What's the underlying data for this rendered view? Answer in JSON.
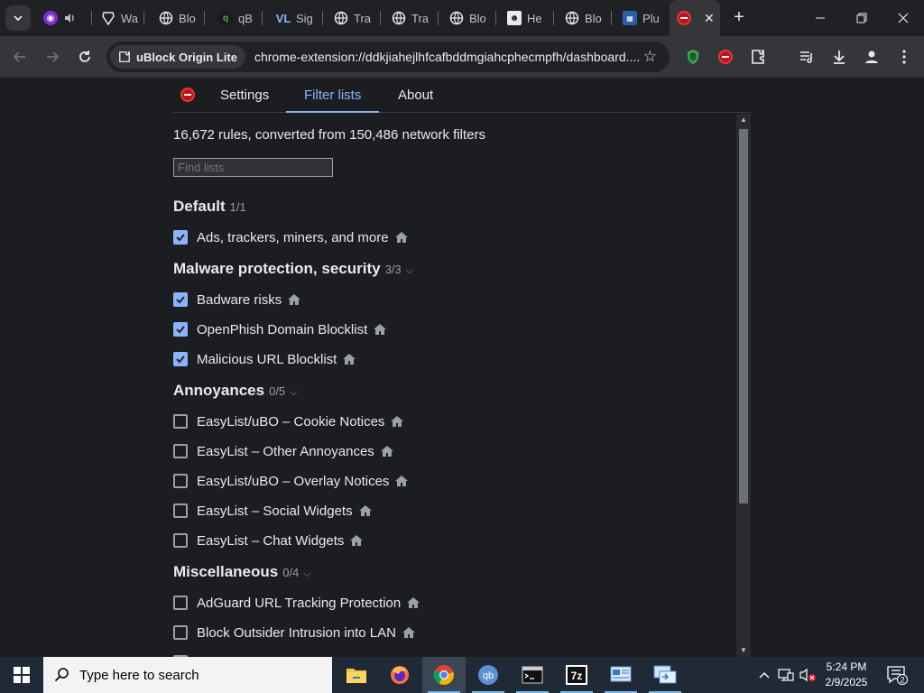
{
  "browser": {
    "tabs": [
      {
        "label": "",
        "icon": "tor-icon"
      },
      {
        "label": "Wa",
        "icon": "brave-icon"
      },
      {
        "label": "Blo",
        "icon": "globe-icon"
      },
      {
        "label": "qB",
        "icon": "qbittorrent-icon"
      },
      {
        "label": "Sig",
        "icon": "vl-icon"
      },
      {
        "label": "Tra",
        "icon": "globe-icon"
      },
      {
        "label": "Tra",
        "icon": "globe-icon"
      },
      {
        "label": "Blo",
        "icon": "globe-icon"
      },
      {
        "label": "He",
        "icon": "hero-icon"
      },
      {
        "label": "Blo",
        "icon": "globe-icon"
      },
      {
        "label": "Plu",
        "icon": "plugin-icon"
      },
      {
        "label": "",
        "icon": "ublock-icon",
        "active": true
      }
    ],
    "extension_chip": "uBlock Origin Lite",
    "url": "chrome-extension://ddkjiahejlhfcafbddmgiahcphecmpfh/dashboard...."
  },
  "dashboard": {
    "nav": {
      "settings": "Settings",
      "filter_lists": "Filter lists",
      "about": "About"
    },
    "summary": "16,672 rules, converted from 150,486 network filters",
    "search_placeholder": "Find lists",
    "groups": [
      {
        "name": "Default",
        "count": "1/1",
        "collapsible": false,
        "lists": [
          {
            "label": "Ads, trackers, miners, and more",
            "checked": true
          }
        ]
      },
      {
        "name": "Malware protection, security",
        "count": "3/3",
        "collapsible": true,
        "lists": [
          {
            "label": "Badware risks",
            "checked": true
          },
          {
            "label": "OpenPhish Domain Blocklist",
            "checked": true
          },
          {
            "label": "Malicious URL Blocklist",
            "checked": true
          }
        ]
      },
      {
        "name": "Annoyances",
        "count": "0/5",
        "collapsible": true,
        "lists": [
          {
            "label": "EasyList/uBO – Cookie Notices",
            "checked": false
          },
          {
            "label": "EasyList – Other Annoyances",
            "checked": false
          },
          {
            "label": "EasyList/uBO – Overlay Notices",
            "checked": false
          },
          {
            "label": "EasyList – Social Widgets",
            "checked": false
          },
          {
            "label": "EasyList – Chat Widgets",
            "checked": false
          }
        ]
      },
      {
        "name": "Miscellaneous",
        "count": "0/4",
        "collapsible": true,
        "lists": [
          {
            "label": "AdGuard URL Tracking Protection",
            "checked": false
          },
          {
            "label": "Block Outsider Intrusion into LAN",
            "checked": false
          }
        ]
      }
    ]
  },
  "taskbar": {
    "search_placeholder": "Type here to search",
    "apps": [
      "file-explorer-icon",
      "firefox-icon",
      "chrome-icon",
      "qbittorrent-icon",
      "terminal-icon",
      "7zip-icon",
      "control-panel-icon",
      "remote-desktop-icon"
    ],
    "time": "5:24 PM",
    "date": "2/9/2025",
    "notification_count": "2"
  },
  "colors": {
    "accent": "#8ab4f8",
    "ublock_red": "#b9141b",
    "page_bg": "#1c1d21",
    "taskbar_bg": "#1f2a36"
  }
}
